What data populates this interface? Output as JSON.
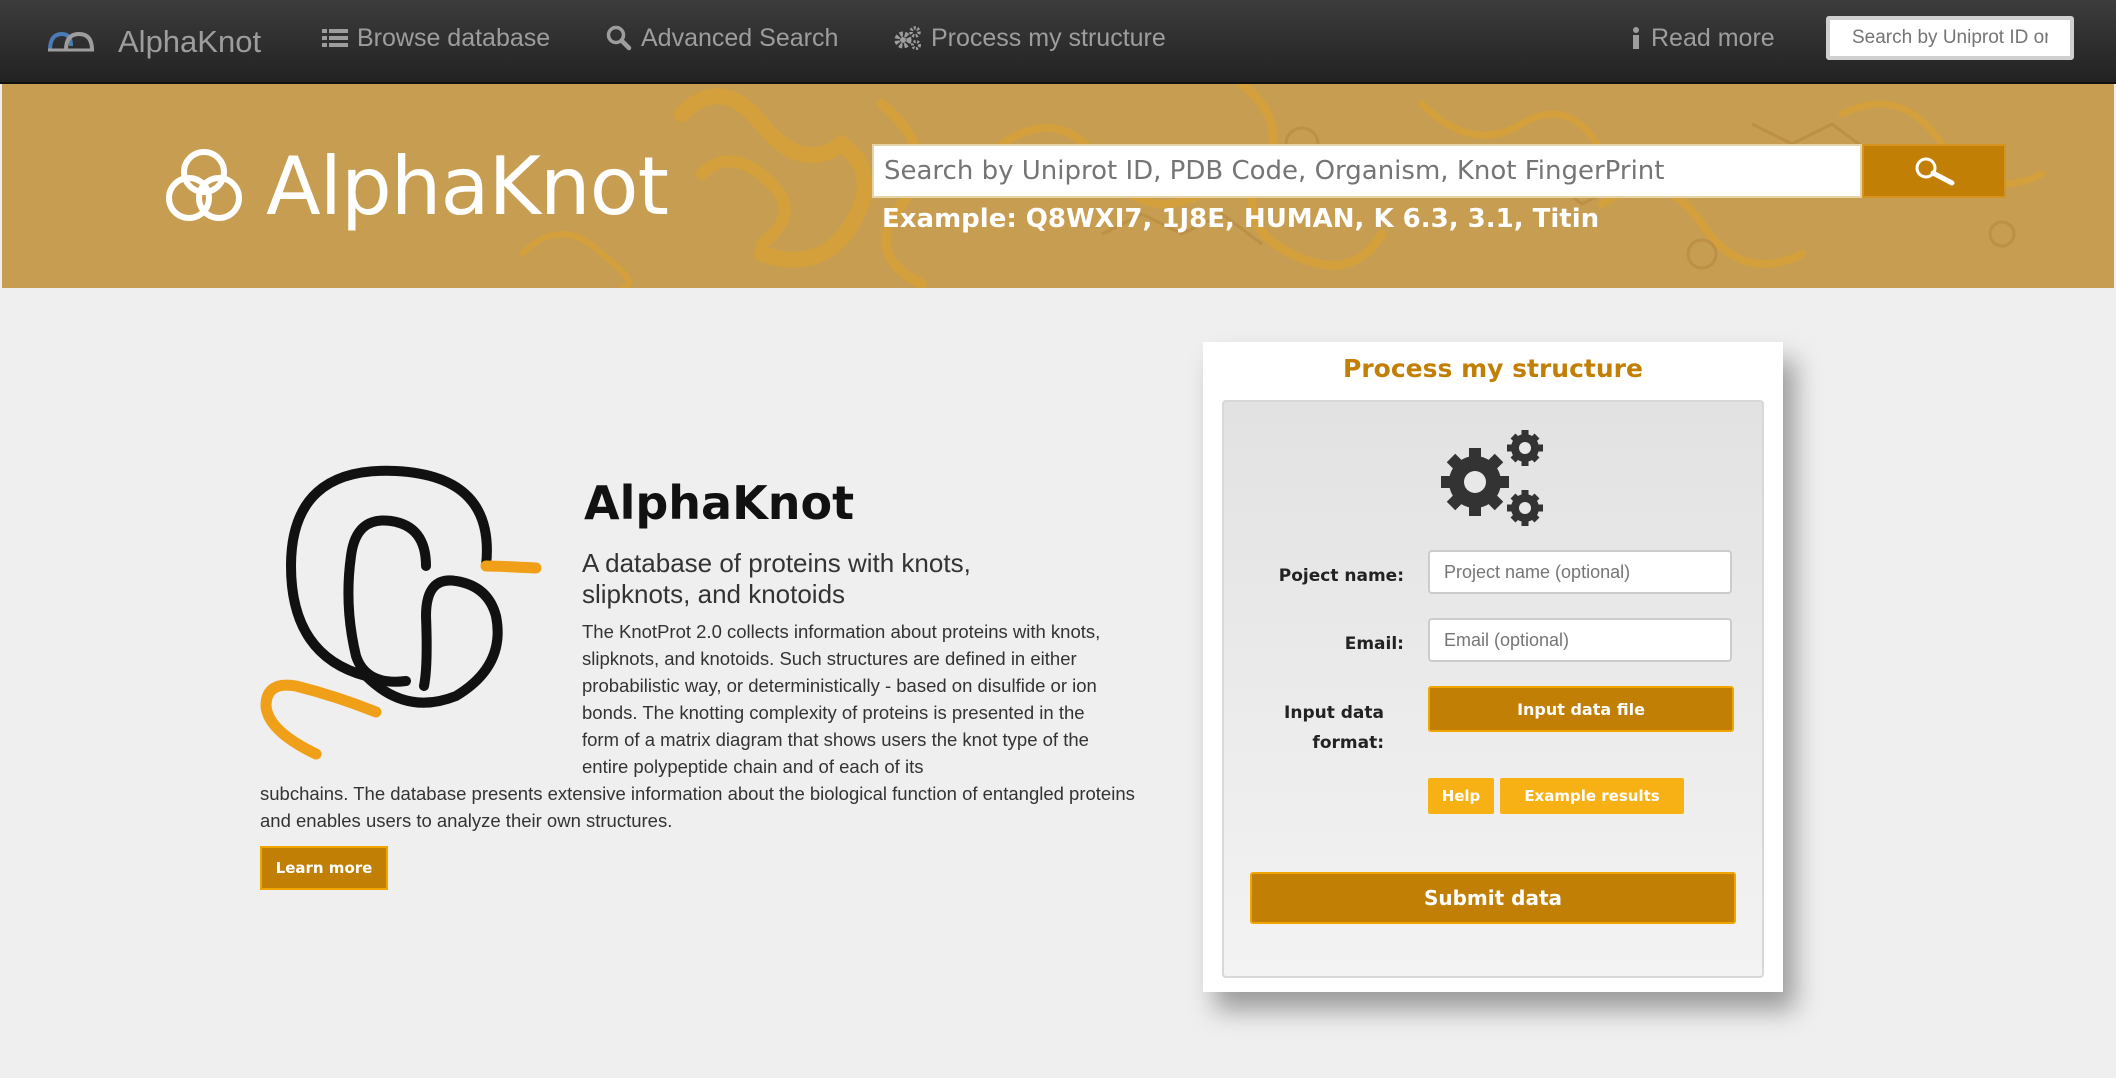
{
  "navbar": {
    "brand": "AlphaKnot",
    "links": {
      "browse": "Browse database",
      "advanced_search": "Advanced Search",
      "process": "Process my structure",
      "read_more": "Read more"
    },
    "search_placeholder": "Search by Uniprot ID or PDB Code"
  },
  "hero": {
    "logo_text": "AlphaKnot",
    "search_placeholder": "Search by Uniprot ID, PDB Code, Organism, Knot FingerPrint",
    "example": "Example: Q8WXI7, 1J8E, HUMAN, K 6.3, 3.1, Titin"
  },
  "about": {
    "title": "AlphaKnot",
    "subtitle": "A database of proteins with knots, slipknots, and knotoids",
    "text_top": "The KnotProt 2.0 collects information about proteins with knots, slipknots, and knotoids. Such structures are defined in either probabilistic way, or deterministically - based on disulfide or ion bonds. The knotting complexity of proteins is presented in the form of a matrix diagram that shows users the knot type of the entire polypeptide chain and of each of its",
    "text_bottom": "subchains. The database presents extensive information about the biological function of entangled proteins and enables users to analyze their own structures.",
    "learn_more": "Learn more"
  },
  "process_panel": {
    "title": "Process my structure",
    "project_label": "Poject name:",
    "project_placeholder": "Project name (optional)",
    "email_label": "Email:",
    "email_placeholder": "Email (optional)",
    "format_label": "Input data format:",
    "input_file_button": "Input data file",
    "help_button": "Help",
    "example_button": "Example results",
    "submit_button": "Submit data"
  },
  "colors": {
    "accent": "#c27f06",
    "accent_light": "#f7b115",
    "hero_bg": "#c79d52",
    "navbar_bg": "#2a2a2a"
  },
  "icons": [
    "brand-logo-icon",
    "list-icon",
    "search-icon",
    "cogs-icon",
    "info-icon",
    "triquetra-icon",
    "magnifier-icon",
    "gears-icon",
    "knot-figure"
  ]
}
